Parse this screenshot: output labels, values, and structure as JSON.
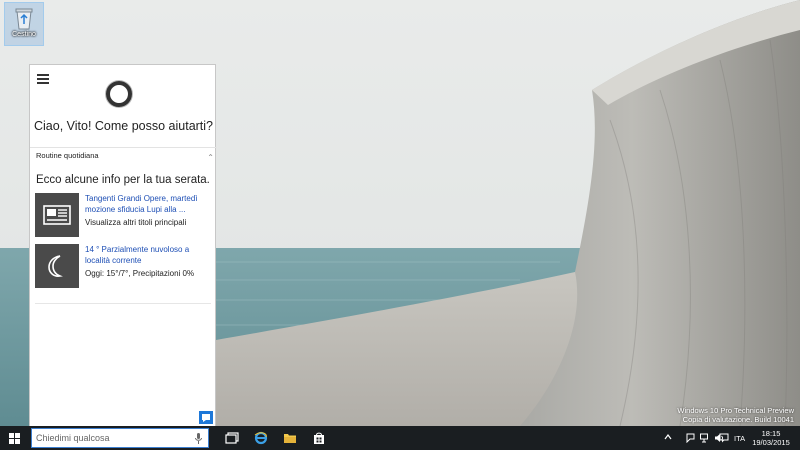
{
  "desktop": {
    "recycle_bin_label": "Cestino",
    "watermark": {
      "line1": "Windows 10 Pro Technical Preview",
      "line2": "Copia di valutazione. Build 10041"
    }
  },
  "cortana": {
    "greeting": "Ciao, Vito! Come posso aiutarti?",
    "section_label": "Routine quotidiana",
    "info_title": "Ecco alcune info per la tua serata.",
    "news": {
      "icon": "newspaper-icon",
      "headline": "Tangenti Grandi Opere, martedì mozione sfiducia Lupi alla ...",
      "subtitle": "Visualizza altri titoli principali"
    },
    "weather": {
      "icon": "moon-icon",
      "headline": "14 ° Parzialmente nuvoloso a località corrente",
      "subtitle": "Oggi: 15°/7°, Precipitazioni 0%"
    }
  },
  "taskbar": {
    "search_placeholder": "Chiedimi qualcosa",
    "language": "ITA",
    "time": "18:15",
    "date": "19/03/2015"
  },
  "colors": {
    "accent": "#1e78d8",
    "link": "#1e4fb5",
    "taskbar": "#1a1e21",
    "tile": "#4a4a4a"
  }
}
